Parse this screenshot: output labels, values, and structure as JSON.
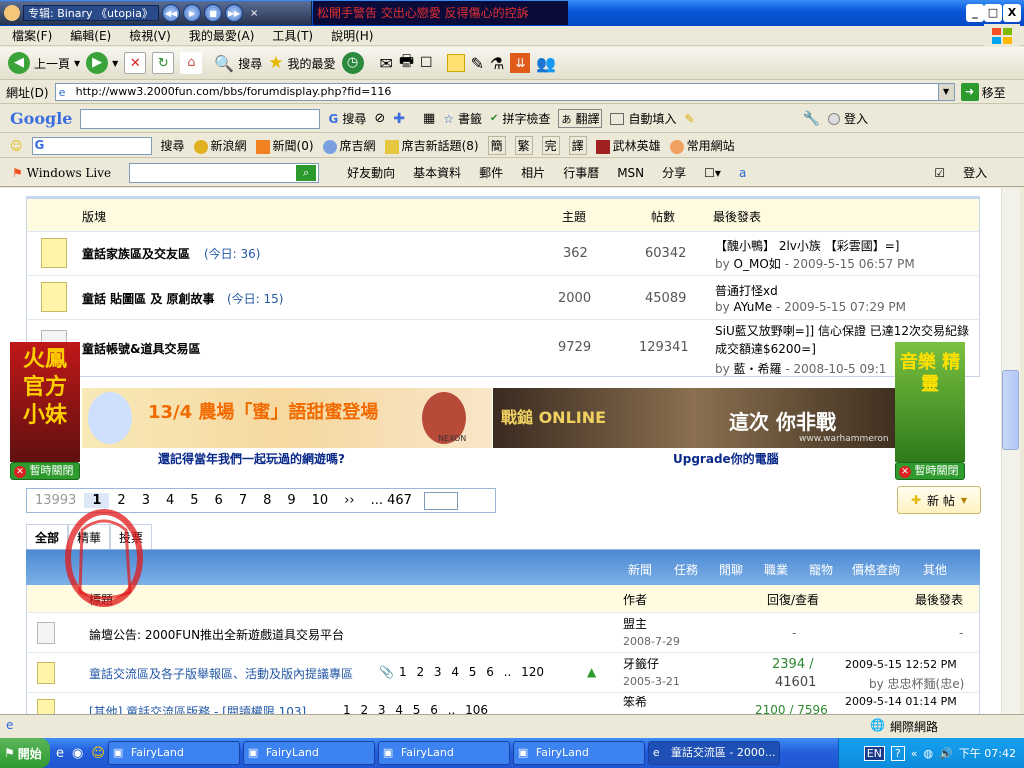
{
  "player": {
    "title": "专辑: Binary 《utopia》",
    "lyric": "松開手警告  交出心戀愛 反得傷心的控訴"
  },
  "window": {
    "minimize": "_",
    "maximize": "□",
    "close": "X"
  },
  "menu": [
    "檔案(F)",
    "編輯(E)",
    "檢視(V)",
    "我的最愛(A)",
    "工具(T)",
    "說明(H)"
  ],
  "toolbar": {
    "back": "上一頁",
    "search": "搜尋",
    "favorites": "我的最愛"
  },
  "address": {
    "label": "網址(D)",
    "url": "http://www3.2000fun.com/bbs/forumdisplay.php?fid=116",
    "go": "移至"
  },
  "google": {
    "logo": "Google",
    "search": "搜尋",
    "bookmarks": "書籤",
    "spell": "拼字檢查",
    "translate": "翻譯",
    "autofill": "自動填入",
    "login": "登入"
  },
  "bar3": {
    "search": "搜尋",
    "sina": "新浪網",
    "news": "新聞(0)",
    "xiji": "席吉網",
    "xiji_topic": "席吉新話題(8)",
    "jian": "簡",
    "fan": "繁",
    "wan": "完",
    "yi": "譯",
    "wulin": "武林英雄",
    "common": "常用網站"
  },
  "live": {
    "brand": "Windows Live",
    "links": [
      "好友動向",
      "基本資料",
      "郵件",
      "相片",
      "行事曆",
      "MSN",
      "分享"
    ],
    "login": "登入"
  },
  "forum": {
    "header": {
      "board": "版塊",
      "topics": "主題",
      "posts": "帖數",
      "last": "最後發表"
    },
    "boards": [
      {
        "name": "童話家族區及交友區",
        "today": "(今日: 36)",
        "topics": "362",
        "posts": "60342",
        "last_title": "【醜小鴨】 2lv小族 【彩雲國】=]",
        "last_by": "by",
        "last_user": "O_MO如",
        "last_time": "- 2009-5-15 06:57 PM"
      },
      {
        "name": "童話 貼圖區 及 原創故事",
        "today": "(今日: 15)",
        "topics": "2000",
        "posts": "45089",
        "last_title": "普通打怪xd",
        "last_by": "by",
        "last_user": "AYuMe",
        "last_time": "- 2009-5-15 07:29 PM"
      },
      {
        "name": "童話帳號&道具交易區",
        "today": "",
        "topics": "9729",
        "posts": "129341",
        "last_title": "SiU藍又放野喇=]] 信心保證 已達12次交易紀錄 成交額達$6200=]",
        "last_by": "by",
        "last_user": "藍・希羅",
        "last_time": "- 2008-10-5 09:1"
      }
    ]
  },
  "ads": {
    "left_badge": "火鳳 官方 小妹",
    "right_badge": "音樂 精靈",
    "close_label": "暫時關閉",
    "banner1_text": "13/4 農場「蜜」語甜蜜登場",
    "banner1_brand": "NEXON",
    "banner1_caption": "還記得當年我們一起玩過的網遊嗎?",
    "banner2_text": "戰鎚 ONLINE",
    "banner2_sub": "這次 你非戰",
    "banner2_url": "www.warhammeron",
    "banner2_caption": "Upgrade你的電腦"
  },
  "pagination": {
    "pages": [
      "13993",
      "1",
      "2",
      "3",
      "4",
      "5",
      "6",
      "7",
      "8",
      "9",
      "10",
      "››",
      "... 467"
    ],
    "new_post": "新 帖"
  },
  "tabs": [
    "全部",
    "精華",
    "投票"
  ],
  "cat_links": [
    "新聞",
    "任務",
    "閒聊",
    "職業",
    "寵物",
    "價格查詢",
    "其他"
  ],
  "thread_head": {
    "title": "標題",
    "author": "作者",
    "replies": "回復/查看",
    "last": "最後發表"
  },
  "threads": [
    {
      "title": "論壇公告: 2000FUN推出全新遊戲道具交易平台",
      "pages": "",
      "author": "盟主",
      "date": "2008-7-29",
      "replies": "-",
      "views": "",
      "last_time": "-",
      "last_user": ""
    },
    {
      "title": "童話交流區及各子版舉報區、活動及版內提議專區",
      "pages": "1 2 3 4 5 6 .. 120",
      "author": "牙籤仔",
      "date": "2005-3-21",
      "replies": "2394 /",
      "views": "41601",
      "last_time": "2009-5-15 12:52 PM",
      "last_user": "by 忠忠杯麵(忠e)"
    },
    {
      "title": "[其他] 童話交流區版務 - [閱讀權限 103]",
      "pages": "1 2 3 4 5 6 .. 106",
      "author": "笨希",
      "date": "",
      "replies": "2100 / 7596",
      "views": "",
      "last_time": "2009-5-14 01:14 PM",
      "last_user": ""
    }
  ],
  "status": {
    "zone": "網際網路"
  },
  "taskbar": {
    "start": "開始",
    "tasks": [
      "FairyLand",
      "FairyLand",
      "FairyLand",
      "FairyLand",
      "童話交流區 - 2000..."
    ],
    "lang": "EN",
    "clock": "下午 07:42"
  }
}
